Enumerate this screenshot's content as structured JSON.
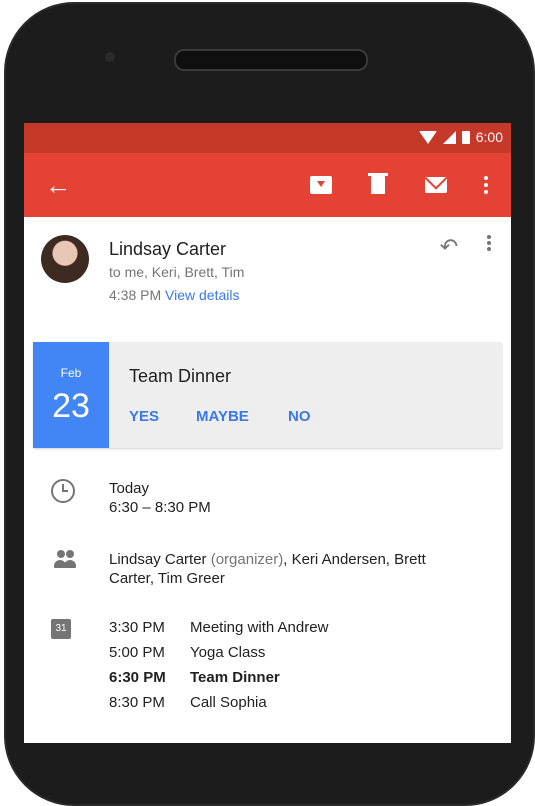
{
  "status_bar": {
    "time": "6:00"
  },
  "app_bar": {
    "back_icon": "arrow-back-icon",
    "actions": [
      "archive-icon",
      "delete-icon",
      "mail-icon",
      "more-vert-icon"
    ]
  },
  "message": {
    "sender": "Lindsay Carter",
    "recipients": "to me, Keri, Brett, Tim",
    "time": "4:38 PM",
    "view_details": "View details"
  },
  "event": {
    "month": "Feb",
    "day": "23",
    "title": "Team Dinner",
    "rsvp": {
      "yes": "YES",
      "maybe": "MAYBE",
      "no": "NO"
    }
  },
  "details": {
    "when": {
      "line1": "Today",
      "line2": "6:30 – 8:30 PM"
    },
    "guests": {
      "name1": "Lindsay Carter",
      "role": "(organizer)",
      "rest": ", Keri Andersen, Brett Carter, Tim Greer"
    },
    "calendar_icon_text": "31",
    "agenda": [
      {
        "time": "3:30 PM",
        "title": "Meeting with Andrew"
      },
      {
        "time": "5:00 PM",
        "title": "Yoga Class"
      },
      {
        "time": "6:30 PM",
        "title": "Team Dinner"
      },
      {
        "time": "8:30 PM",
        "title": "Call Sophia"
      }
    ]
  },
  "colors": {
    "status_bar": "#c5392b",
    "app_bar": "#e34234",
    "accent": "#4285f4",
    "link": "#3b78e7"
  }
}
